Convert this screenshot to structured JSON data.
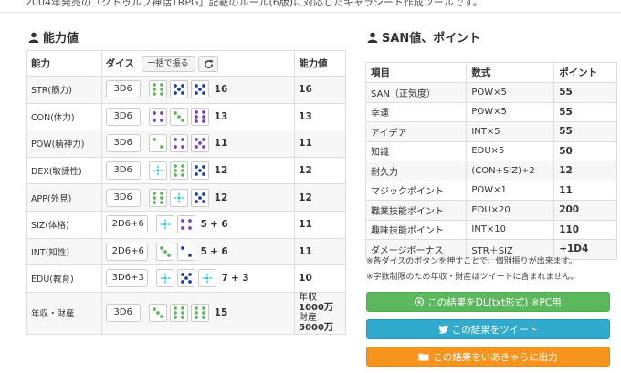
{
  "intro_fragment": "2004年発売の「クトゥルフ神話TRPG」記載のルール(6版)に対応したキャラシート作成ツールです。",
  "colors": {
    "green_pip": "#5cb85c",
    "navy_pip": "#1f3fa3",
    "purple_pip": "#7b3fc4",
    "cyan_pip": "#1ec8d8",
    "action_green": "#5cb85c",
    "action_blue": "#30aacd",
    "action_orange": "#f7941d"
  },
  "ability": {
    "title": "能力値",
    "icon": "user-icon",
    "headers": {
      "name": "能力",
      "dice": "ダイス",
      "roll_all": "一括で振る",
      "reroll_icon": "refresh-icon",
      "value": "能力値"
    },
    "rows": [
      {
        "name": "STR(筋力)",
        "formula": "3D6",
        "dice": [
          {
            "face": 6,
            "color": "green"
          },
          {
            "face": 5,
            "color": "navy"
          },
          {
            "face": 5,
            "color": "navy"
          }
        ],
        "extra": "",
        "total": "16",
        "value": "16"
      },
      {
        "name": "CON(体力)",
        "formula": "3D6",
        "dice": [
          {
            "face": 4,
            "color": "purple"
          },
          {
            "face": 3,
            "color": "green"
          },
          {
            "face": 6,
            "color": "purple"
          }
        ],
        "extra": "",
        "total": "13",
        "value": "13"
      },
      {
        "name": "POW(精神力)",
        "formula": "3D6",
        "dice": [
          {
            "face": 2,
            "color": "green"
          },
          {
            "face": 4,
            "color": "purple"
          },
          {
            "face": 5,
            "color": "purple"
          }
        ],
        "extra": "",
        "total": "11",
        "value": "11"
      },
      {
        "name": "DEX(敏捷性)",
        "formula": "3D6",
        "dice": [
          {
            "face": 1,
            "color": "cyan"
          },
          {
            "face": 6,
            "color": "green"
          },
          {
            "face": 5,
            "color": "navy"
          }
        ],
        "extra": "",
        "total": "12",
        "value": "12"
      },
      {
        "name": "APP(外見)",
        "formula": "3D6",
        "dice": [
          {
            "face": 6,
            "color": "green"
          },
          {
            "face": 1,
            "color": "cyan"
          },
          {
            "face": 5,
            "color": "navy"
          }
        ],
        "extra": "",
        "total": "12",
        "value": "12"
      },
      {
        "name": "SIZ(体格)",
        "formula": "2D6+6",
        "dice": [
          {
            "face": 1,
            "color": "cyan"
          },
          {
            "face": 4,
            "color": "purple"
          }
        ],
        "extra": "+ 6",
        "total": "5",
        "value": "11"
      },
      {
        "name": "INT(知性)",
        "formula": "2D6+6",
        "dice": [
          {
            "face": 3,
            "color": "green"
          },
          {
            "face": 2,
            "color": "navy"
          }
        ],
        "extra": "+ 6",
        "total": "5",
        "value": "11"
      },
      {
        "name": "EDU(教育)",
        "formula": "3D6+3",
        "dice": [
          {
            "face": 1,
            "color": "cyan"
          },
          {
            "face": 5,
            "color": "navy"
          },
          {
            "face": 1,
            "color": "cyan"
          }
        ],
        "extra": "+ 3",
        "total": "7",
        "value": "10"
      },
      {
        "name": "年収・財産",
        "formula": "3D6",
        "dice": [
          {
            "face": 3,
            "color": "green"
          },
          {
            "face": 6,
            "color": "green"
          },
          {
            "face": 6,
            "color": "green"
          }
        ],
        "extra": "",
        "total": "15",
        "wealth": {
          "income_label": "年収",
          "income": "1000万",
          "assets_label": "財産",
          "assets": "5000万"
        }
      }
    ]
  },
  "san": {
    "title": "SAN値、ポイント",
    "icon": "user-icon",
    "headers": {
      "item": "項目",
      "formula": "数式",
      "points": "ポイント"
    },
    "rows": [
      {
        "item": "SAN（正気度）",
        "formula": "POW×5",
        "points": "55"
      },
      {
        "item": "幸運",
        "formula": "POW×5",
        "points": "55"
      },
      {
        "item": "アイデア",
        "formula": "INT×5",
        "points": "55"
      },
      {
        "item": "知識",
        "formula": "EDU×5",
        "points": "50"
      },
      {
        "item": "耐久力",
        "formula": "(CON+SIZ)÷2",
        "points": "12"
      },
      {
        "item": "マジックポイント",
        "formula": "POW×1",
        "points": "11"
      },
      {
        "item": "職業技能ポイント",
        "formula": "EDU×20",
        "points": "200"
      },
      {
        "item": "趣味技能ポイント",
        "formula": "INT×10",
        "points": "110"
      },
      {
        "item": "ダメージボーナス",
        "formula": "STR＋SIZ",
        "points": "+1D4"
      }
    ]
  },
  "notes": [
    "※各ダイスのボタンを押すことで、個別振りが出来ます。",
    "※字数制限のため年収・財産はツイートに含まれません。"
  ],
  "actions": {
    "download": {
      "label": "この結果をDL(txt形式) ※PC用",
      "icon": "download-icon"
    },
    "tweet": {
      "label": "この結果をツイート",
      "icon": "twitter-icon"
    },
    "export": {
      "label": "この結果をいあきゃらに出力",
      "icon": "export-icon"
    }
  }
}
